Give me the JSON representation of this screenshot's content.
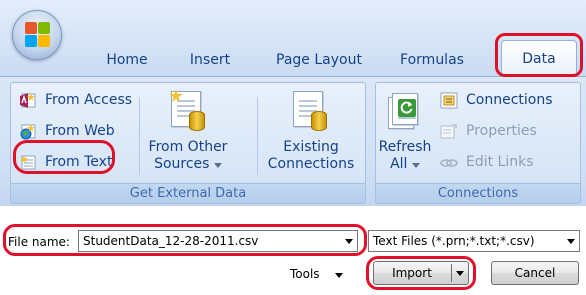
{
  "ribbon": {
    "tabs": [
      {
        "label": "Home"
      },
      {
        "label": "Insert"
      },
      {
        "label": "Page Layout"
      },
      {
        "label": "Formulas"
      },
      {
        "label": "Data"
      }
    ],
    "get_external_data": {
      "label": "Get External Data",
      "from_access": "From Access",
      "from_web": "From Web",
      "from_text": "From Text",
      "from_other_sources": {
        "line1": "From Other",
        "line2": "Sources"
      },
      "existing_connections": {
        "line1": "Existing",
        "line2": "Connections"
      }
    },
    "connections_group": {
      "label": "Connections",
      "refresh_all": {
        "line1": "Refresh",
        "line2": "All"
      },
      "connections": "Connections",
      "properties": "Properties",
      "edit_links": "Edit Links"
    }
  },
  "dialog": {
    "file_name_label": "File name:",
    "file_name_value": "StudentData_12-28-2011.csv",
    "file_type_value": "Text Files (*.prn;*.txt;*.csv)",
    "tools_label": "Tools",
    "import_label": "Import",
    "cancel_label": "Cancel"
  },
  "colors": {
    "highlight": "#e0102a",
    "ribbon_text": "#15428b"
  }
}
